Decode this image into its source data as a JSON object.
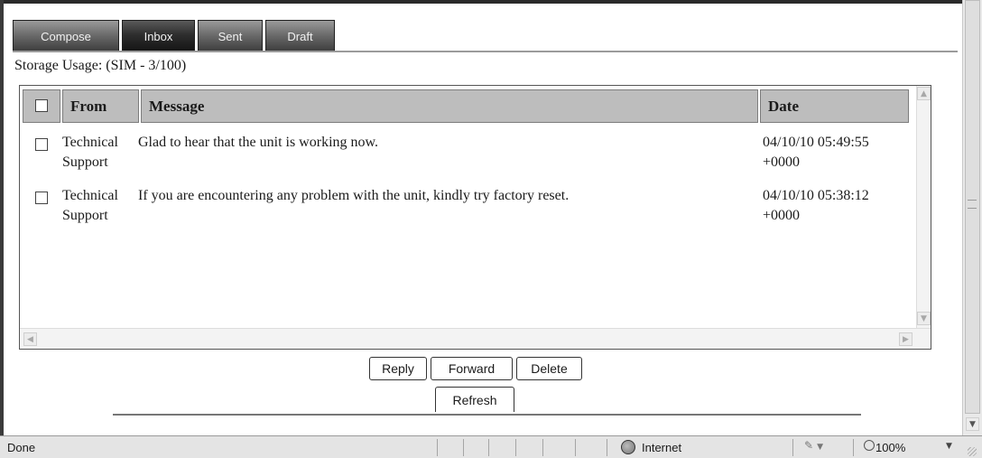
{
  "tabs": [
    {
      "label": "Compose",
      "active": false
    },
    {
      "label": "Inbox",
      "active": true
    },
    {
      "label": "Sent",
      "active": false
    },
    {
      "label": "Draft",
      "active": false
    }
  ],
  "storage_label": "Storage Usage: (SIM - 3/100)",
  "table": {
    "columns": [
      "From",
      "Message",
      "Date"
    ],
    "rows": [
      {
        "from_line1": "Technical",
        "from_line2": "Support",
        "message": "Glad to hear that the unit is working now.",
        "date_line1": "04/10/10 05:49:55",
        "date_line2": "+0000"
      },
      {
        "from_line1": "Technical",
        "from_line2": "Support",
        "message": "If you are encountering any problem with the unit, kindly try factory reset.",
        "date_line1": "04/10/10 05:38:12",
        "date_line2": "+0000"
      }
    ]
  },
  "buttons": {
    "reply": "Reply",
    "forward": "Forward",
    "delete": "Delete",
    "refresh": "Refresh"
  },
  "statusbar": {
    "text": "Done",
    "zone": "Internet",
    "zoom": "100%"
  },
  "icons": {
    "zone": "globe-icon",
    "protected_mode": "lock-icon",
    "zoom": "magnifier-icon"
  },
  "colors": {
    "tab_inactive": "#6c6c6c",
    "tab_active": "#1e1e1e",
    "header_bg": "#bdbdbd"
  }
}
